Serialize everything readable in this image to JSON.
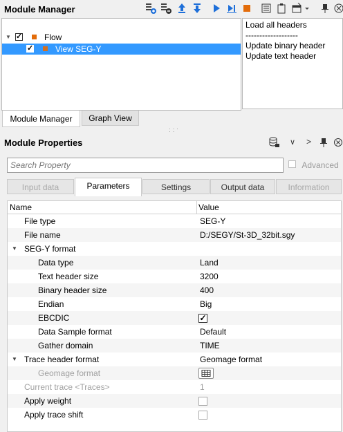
{
  "module_manager": {
    "title": "Module Manager",
    "toolbar_icons": [
      "add-module-icon",
      "remove-module-icon",
      "move-up-icon",
      "move-down-icon",
      "run-icon",
      "run-step-icon",
      "stop-icon",
      "list-icon",
      "clipboard-icon",
      "window-icon",
      "dropdown-icon",
      "pin-icon",
      "close-icon"
    ],
    "tree": {
      "root": {
        "label": "Flow",
        "checked": true
      },
      "child": {
        "label": "View SEG-Y",
        "checked": true,
        "selected": true
      }
    },
    "info": {
      "line1": "Load all headers",
      "line2": "-------------------",
      "line3": "Update binary header",
      "line4": "Update text header"
    },
    "tabs": [
      {
        "label": "Module Manager",
        "active": true
      },
      {
        "label": "Graph View",
        "active": false
      }
    ]
  },
  "module_properties": {
    "title": "Module Properties",
    "search_placeholder": "Search Property",
    "advanced_label": "Advanced",
    "tabs": [
      {
        "label": "Input data",
        "state": "disabled"
      },
      {
        "label": "Parameters",
        "state": "active"
      },
      {
        "label": "Settings",
        "state": "normal"
      },
      {
        "label": "Output data",
        "state": "normal"
      },
      {
        "label": "Information",
        "state": "disabled"
      }
    ],
    "grid": {
      "col_name": "Name",
      "col_value": "Value",
      "file_type": {
        "name": "File type",
        "value": "SEG-Y"
      },
      "file_name": {
        "name": "File name",
        "value": "D:/SEGY/St-3D_32bit.sgy"
      },
      "segy_format": {
        "name": "SEG-Y format"
      },
      "data_type": {
        "name": "Data type",
        "value": "Land"
      },
      "text_header_size": {
        "name": "Text header size",
        "value": "3200"
      },
      "binary_header_size": {
        "name": "Binary header size",
        "value": "400"
      },
      "endian": {
        "name": "Endian",
        "value": "Big"
      },
      "ebcdic": {
        "name": "EBCDIC",
        "checked": true
      },
      "data_sample_format": {
        "name": "Data Sample format",
        "value": "Default"
      },
      "gather_domain": {
        "name": "Gather domain",
        "value": "TIME"
      },
      "trace_header_format": {
        "name": "Trace header format",
        "value": "Geomage format"
      },
      "geomage_format": {
        "name": "Geomage format"
      },
      "current_trace": {
        "name": "Current trace <Traces>",
        "value": "1"
      },
      "apply_weight": {
        "name": "Apply weight",
        "checked": false
      },
      "apply_trace_shift": {
        "name": "Apply trace shift",
        "checked": false
      }
    }
  }
}
